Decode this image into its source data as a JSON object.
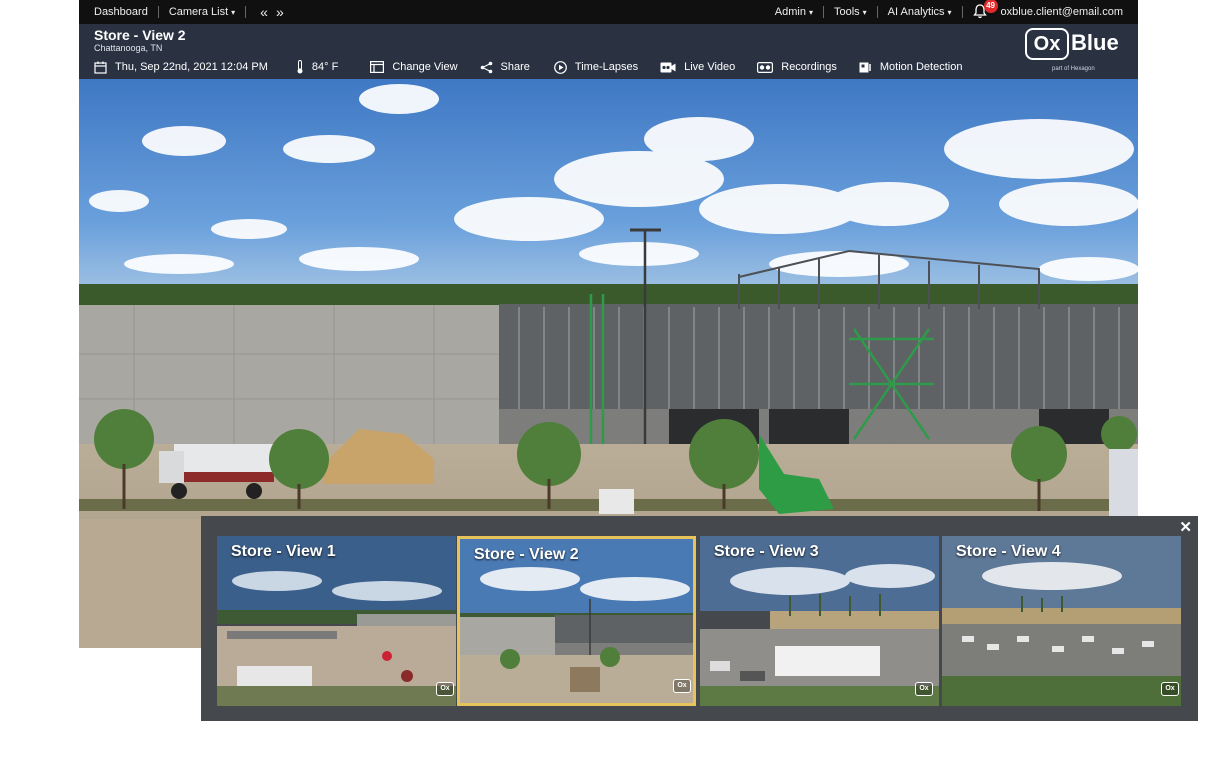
{
  "nav": {
    "dashboard": "Dashboard",
    "camera_list": "Camera List",
    "prev_arrow": "«",
    "next_arrow": "»",
    "admin": "Admin",
    "tools": "Tools",
    "ai_analytics": "AI Analytics",
    "notification_count": "49",
    "user_email": "oxblue.client@email.com",
    "caret": "▾"
  },
  "header": {
    "title": "Store - View 2",
    "location": "Chattanooga, TN",
    "datetime": "Thu, Sep 22nd, 2021 12:04 PM",
    "temperature": "84° F"
  },
  "toolbar": {
    "change_view": "Change View",
    "share": "Share",
    "time_lapses": "Time-Lapses",
    "live_video": "Live Video",
    "recordings": "Recordings",
    "motion_detection": "Motion Detection"
  },
  "logo": {
    "box": "Ox",
    "word": "Blue",
    "sub": "part of Hexagon"
  },
  "strip": {
    "close": "✕",
    "watermark": "Ox",
    "views": [
      {
        "label": "Store - View 1"
      },
      {
        "label": "Store - View 2"
      },
      {
        "label": "Store - View 3"
      },
      {
        "label": "Store - View 4"
      }
    ]
  },
  "colors": {
    "header_bg": "#2a3242",
    "topbar_bg": "#101010",
    "selected_border": "#e8c35a",
    "badge": "#e02b2b"
  },
  "icons": [
    "calendar-icon",
    "thermometer-icon",
    "change-view-icon",
    "share-icon",
    "play-icon",
    "live-video-icon",
    "recordings-icon",
    "motion-detection-icon",
    "bell-icon"
  ]
}
